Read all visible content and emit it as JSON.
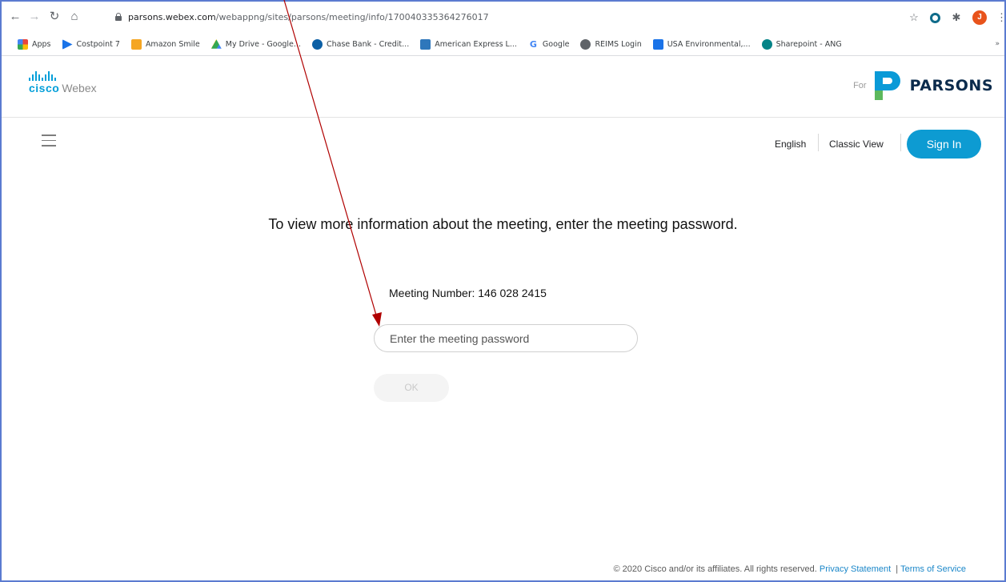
{
  "browser": {
    "url_host": "parsons.webex.com",
    "url_path": "/webappng/sites/parsons/meeting/info/170040335364276017",
    "bookmarks": [
      {
        "label": "Apps",
        "icon": "apps-grid-icon",
        "color": "#e8453c"
      },
      {
        "label": "Costpoint 7",
        "icon": "costpoint-icon",
        "color": "#1a73e8"
      },
      {
        "label": "Amazon Smile",
        "icon": "amazon-icon",
        "color": "#f5a623"
      },
      {
        "label": "My Drive - Google...",
        "icon": "google-drive-icon",
        "color": "#34a853"
      },
      {
        "label": "Chase Bank - Credit...",
        "icon": "chase-icon",
        "color": "#0b5fa5"
      },
      {
        "label": "American Express L...",
        "icon": "amex-icon",
        "color": "#2e77bb"
      },
      {
        "label": "Google",
        "icon": "google-icon",
        "color": "#4285f4"
      },
      {
        "label": "REIMS Login",
        "icon": "globe-icon",
        "color": "#5f6368"
      },
      {
        "label": "USA Environmental,...",
        "icon": "usa-env-icon",
        "color": "#1a73e8"
      },
      {
        "label": "Sharepoint - ANG",
        "icon": "sharepoint-icon",
        "color": "#038387"
      }
    ],
    "more_bookmarks": "»",
    "profile_initial": "J"
  },
  "header": {
    "cisco_brand": "cisco",
    "product": "Webex",
    "for_label": "For",
    "partner": "PARSONS"
  },
  "nav": {
    "language": "English",
    "classic_view": "Classic View",
    "sign_in": "Sign In"
  },
  "main": {
    "prompt": "To view more information about the meeting, enter the meeting password.",
    "meeting_number": "Meeting Number: 146 028 2415",
    "password_placeholder": "Enter the meeting password",
    "ok_label": "OK"
  },
  "footer": {
    "copyright": "© 2020 Cisco and/or its affiliates. All rights reserved.",
    "privacy": "Privacy Statement",
    "separator": "|",
    "terms": "Terms of Service"
  },
  "colors": {
    "accent": "#0d9bd2",
    "annotation": "#b00000"
  }
}
